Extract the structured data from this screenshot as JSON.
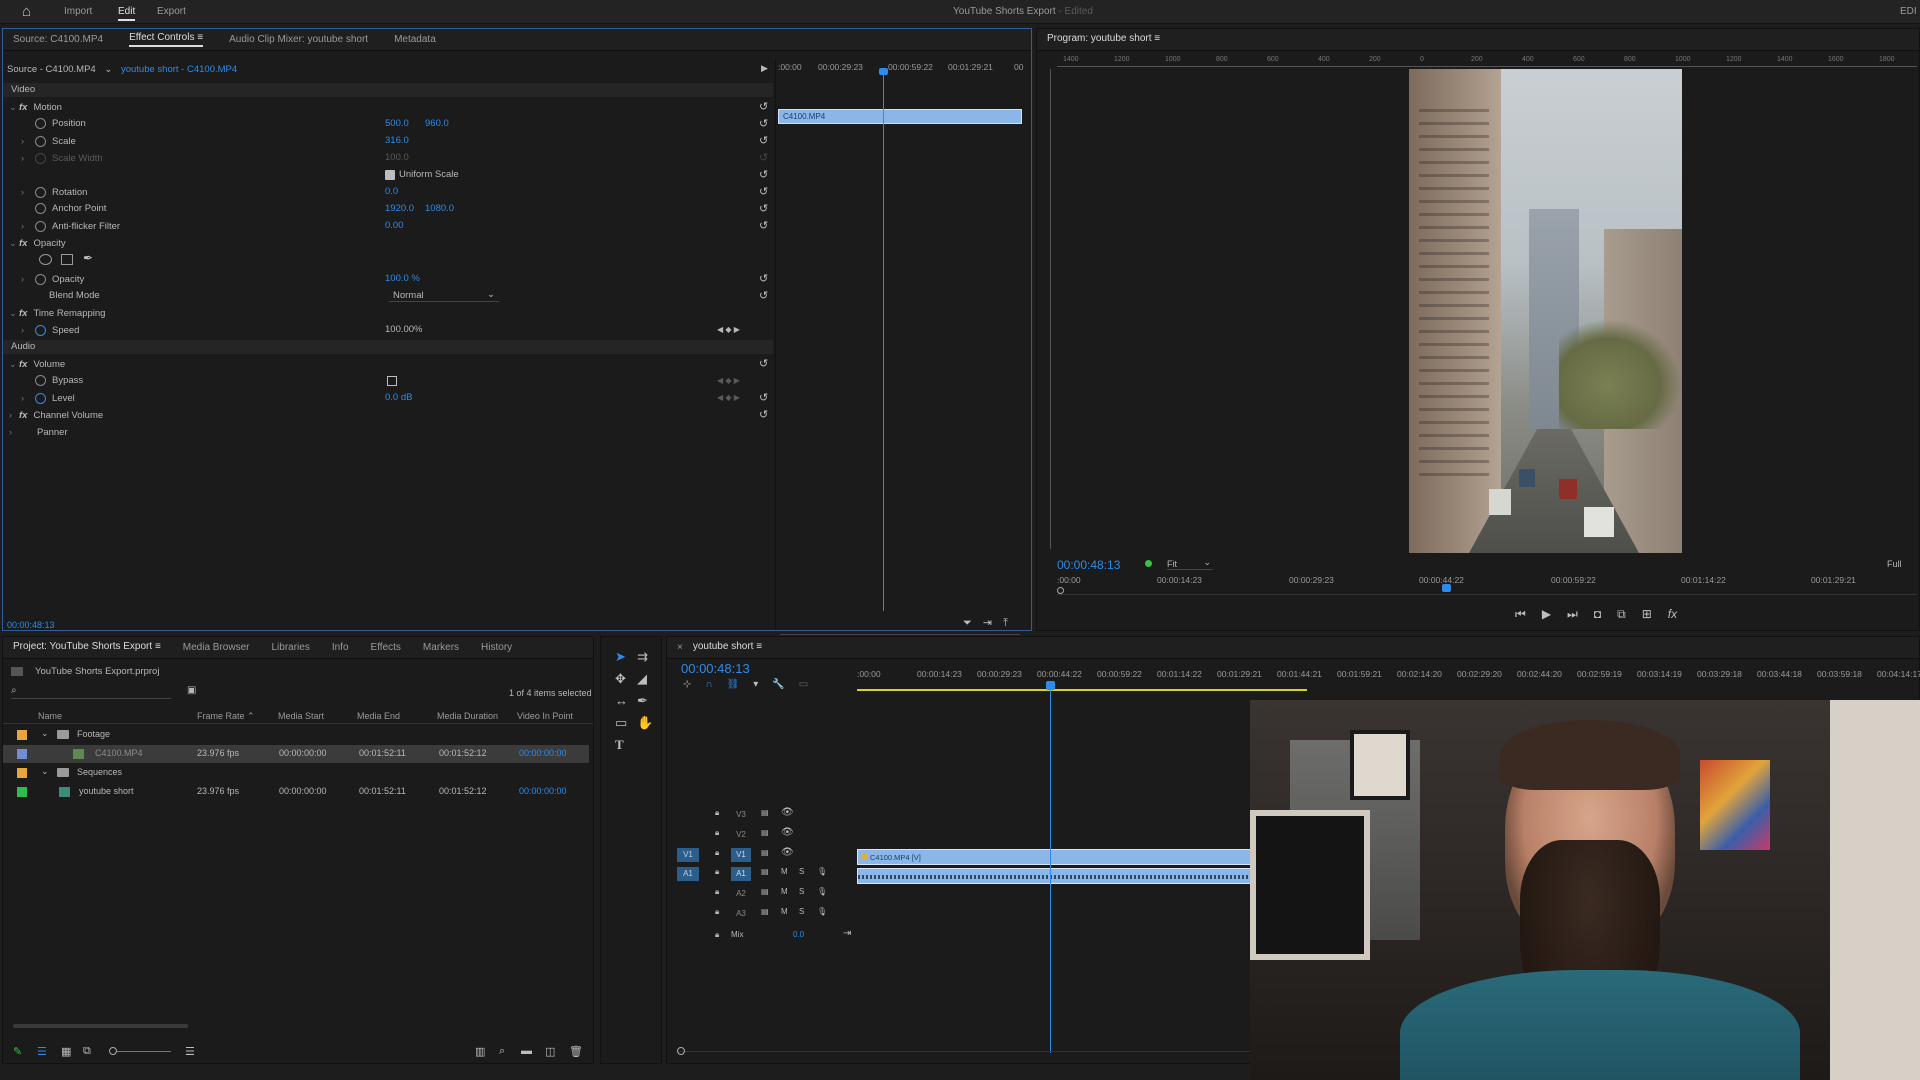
{
  "topbar": {
    "home": "home-icon",
    "menu": [
      "Import",
      "Edit",
      "Export"
    ],
    "active": "Edit",
    "title": "YouTube Shorts Export",
    "title_suffix": "- Edited",
    "right": "EDI"
  },
  "source_panel": {
    "tabs": [
      "Source: C4100.MP4",
      "Effect Controls",
      "Audio Clip Mixer: youtube short",
      "Metadata"
    ],
    "active_tab": "Effect Controls",
    "clip_source": "Source - C4100.MP4",
    "clip_seq": "youtube short - C4100.MP4",
    "ruler": [
      ":00:00",
      "00:00:29:23",
      "00:00:59:22",
      "00:01:29:21",
      "00"
    ],
    "clip_bar": "C4100.MP4",
    "sections": {
      "video": "Video",
      "audio": "Audio"
    },
    "props": {
      "motion": "Motion",
      "position": "Position",
      "position_x": "500.0",
      "position_y": "960.0",
      "scale": "Scale",
      "scale_val": "316.0",
      "scale_width": "Scale Width",
      "scale_width_val": "100.0",
      "uniform_scale": "Uniform Scale",
      "rotation": "Rotation",
      "rotation_val": "0.0",
      "anchor": "Anchor Point",
      "anchor_x": "1920.0",
      "anchor_y": "1080.0",
      "antiflicker": "Anti-flicker Filter",
      "antiflicker_val": "0.00",
      "opacity_group": "Opacity",
      "opacity": "Opacity",
      "opacity_val": "100.0 %",
      "blend": "Blend Mode",
      "blend_val": "Normal",
      "time_remap": "Time Remapping",
      "speed": "Speed",
      "speed_val": "100.00%",
      "volume": "Volume",
      "bypass": "Bypass",
      "level": "Level",
      "level_val": "0.0 dB",
      "channel_volume": "Channel Volume",
      "panner": "Panner"
    },
    "timecode": "00:00:48:13"
  },
  "program": {
    "tab": "Program: youtube short",
    "ruler_nums": [
      "1400",
      "1200",
      "1000",
      "800",
      "600",
      "400",
      "200",
      "0",
      "200",
      "400",
      "600",
      "800",
      "1000",
      "1200",
      "1400",
      "1600",
      "1800"
    ],
    "timecode": "00:00:48:13",
    "fit": "Fit",
    "full": "Full",
    "ruler": [
      ":00:00",
      "00:00:14:23",
      "00:00:29:23",
      "00:00:44:22",
      "00:00:59:22",
      "00:01:14:22",
      "00:01:29:21"
    ]
  },
  "project": {
    "tabs": [
      "Project: YouTube Shorts Export",
      "Media Browser",
      "Libraries",
      "Info",
      "Effects",
      "Markers",
      "History"
    ],
    "active_tab": "Project: YouTube Shorts Export",
    "file": "YouTube Shorts Export.prproj",
    "selection": "1 of 4 items selected",
    "columns": [
      "Name",
      "Frame Rate",
      "Media Start",
      "Media End",
      "Media Duration",
      "Video In Point"
    ],
    "rows": [
      {
        "name": "Footage",
        "indent": 0,
        "kind": "bin",
        "color": "#e7a53d",
        "rate": "",
        "start": "",
        "end": "",
        "dur": "",
        "vin": ""
      },
      {
        "name": "C4100.MP4",
        "indent": 1,
        "kind": "clip",
        "color": "#6f8fd0",
        "rate": "23.976 fps",
        "start": "00:00:00:00",
        "end": "00:01:52:11",
        "dur": "00:01:52:12",
        "vin": "00:00:00:00",
        "selected": true
      },
      {
        "name": "Sequences",
        "indent": 0,
        "kind": "bin",
        "color": "#e7a53d",
        "rate": "",
        "start": "",
        "end": "",
        "dur": "",
        "vin": ""
      },
      {
        "name": "youtube short",
        "indent": 1,
        "kind": "seq",
        "color": "#2dbf4e",
        "rate": "23.976 fps",
        "start": "00:00:00:00",
        "end": "00:01:52:11",
        "dur": "00:01:52:12",
        "vin": "00:00:00:00"
      }
    ]
  },
  "timeline": {
    "tab": "youtube short",
    "timecode": "00:00:48:13",
    "ruler": [
      ":00:00",
      "00:00:14:23",
      "00:00:29:23",
      "00:00:44:22",
      "00:00:59:22",
      "00:01:14:22",
      "00:01:29:21",
      "00:01:44:21",
      "00:01:59:21",
      "00:02:14:20",
      "00:02:29:20",
      "00:02:44:20",
      "00:02:59:19",
      "00:03:14:19",
      "00:03:29:18",
      "00:03:44:18",
      "00:03:59:18",
      "00:04:14:17"
    ],
    "tracks": [
      "V3",
      "V2",
      "V1",
      "A1",
      "A2",
      "A3"
    ],
    "clip_label": "C4100.MP4 [V]",
    "mix_label": "Mix",
    "mix_val": "0.0",
    "mute": "M",
    "solo": "S"
  },
  "colors": {
    "accent": "#2d8ceb",
    "clip_blue": "#8ab6e8",
    "work_yellow": "#d8d228"
  }
}
